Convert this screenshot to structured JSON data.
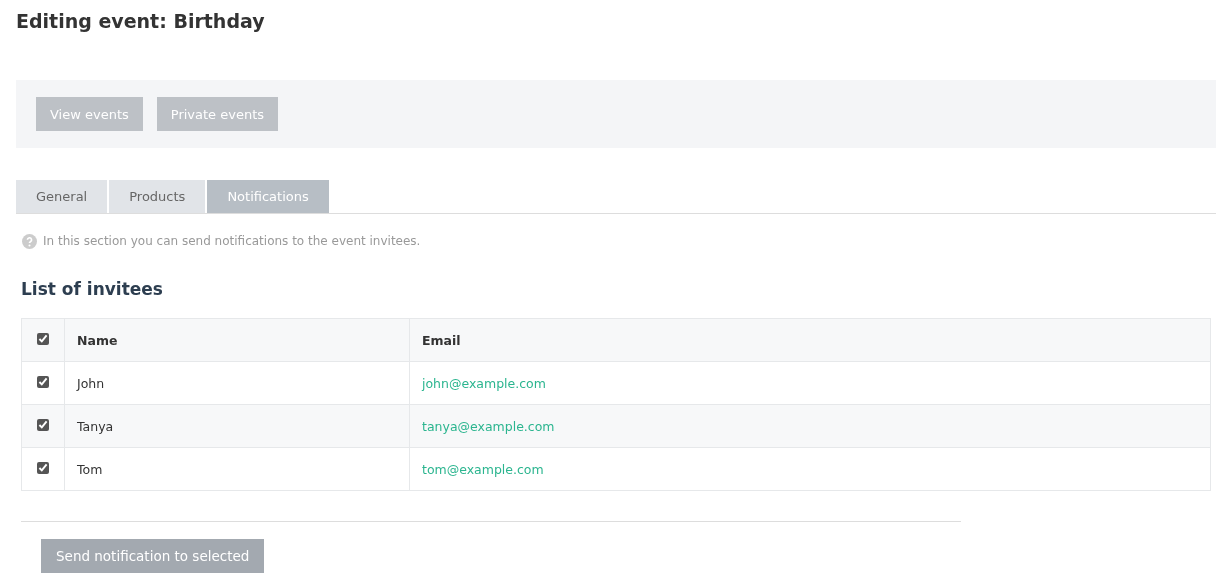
{
  "page_title": "Editing event: Birthday",
  "toolbar_buttons": [
    {
      "label": "View events"
    },
    {
      "label": "Private events"
    }
  ],
  "tabs": [
    {
      "label": "General",
      "selected": false
    },
    {
      "label": "Products",
      "selected": false
    },
    {
      "label": "Notifications",
      "selected": true
    }
  ],
  "help_text": "In this section you can send notifications to the event invitees.",
  "section_title": "List of invitees",
  "table": {
    "select_all_checked": true,
    "columns": [
      "Name",
      "Email"
    ],
    "rows": [
      {
        "checked": true,
        "name": "John",
        "email": "john@example.com"
      },
      {
        "checked": true,
        "name": "Tanya",
        "email": "tanya@example.com"
      },
      {
        "checked": true,
        "name": "Tom",
        "email": "tom@example.com"
      }
    ]
  },
  "send_button": {
    "label": "Send notification to selected",
    "disabled": true
  }
}
